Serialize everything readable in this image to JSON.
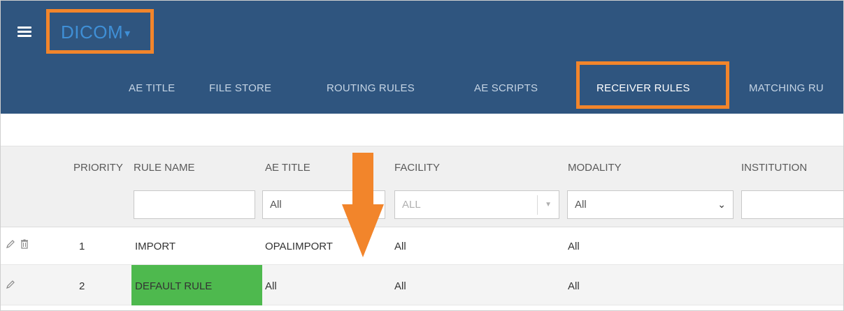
{
  "header": {
    "app_title": "DICOM",
    "app_title_caret": "▾",
    "menu_icon": "hamburger-menu-icon"
  },
  "tabs": [
    {
      "label": "AE TITLE",
      "active": false
    },
    {
      "label": "FILE STORE",
      "active": false
    },
    {
      "label": "ROUTING RULES",
      "active": false
    },
    {
      "label": "AE SCRIPTS",
      "active": false
    },
    {
      "label": "RECEIVER RULES",
      "active": true
    },
    {
      "label": "MATCHING RU",
      "active": false
    }
  ],
  "table": {
    "columns": [
      "PRIORITY",
      "RULE NAME",
      "AE TITLE",
      "FACILITY",
      "MODALITY",
      "INSTITUTION"
    ],
    "filters": {
      "rule_name": "",
      "ae_title": "All",
      "facility": "ALL",
      "modality": "All",
      "institution": ""
    },
    "rows": [
      {
        "priority": "1",
        "rule_name": "IMPORT",
        "ae_title": "OPALIMPORT",
        "facility": "All",
        "modality": "All",
        "institution": "",
        "deletable": true
      },
      {
        "priority": "2",
        "rule_name": "DEFAULT RULE",
        "ae_title": "All",
        "facility": "All",
        "modality": "All",
        "institution": "",
        "deletable": false
      }
    ]
  },
  "colors": {
    "topbar": "#2f557f",
    "accent_orange": "#f2852b",
    "title_blue": "#3f8fd6",
    "row_highlight_green": "#4eb94e"
  },
  "icons": {
    "edit": "pencil-icon",
    "delete": "trash-icon",
    "dropdown": "chevron-down-icon",
    "annotation": "down-arrow-annotation"
  }
}
